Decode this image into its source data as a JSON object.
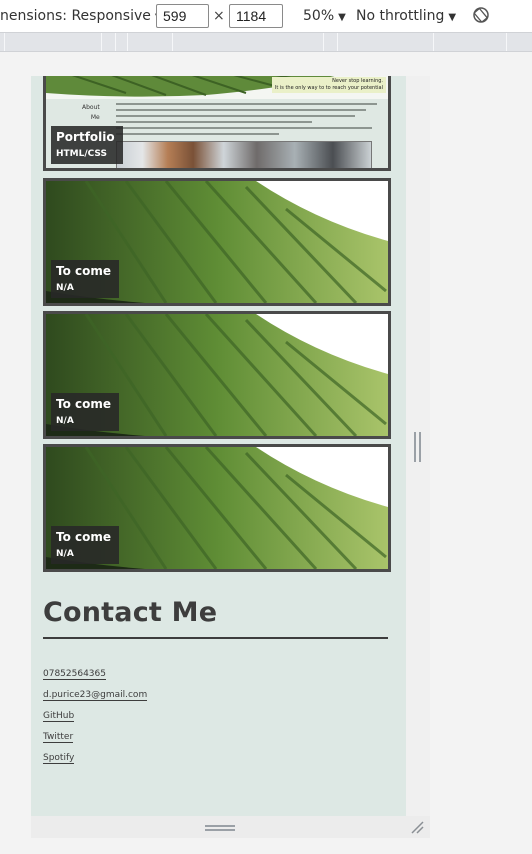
{
  "toolbar": {
    "dimensions_label": "nensions: Responsive",
    "width_value": "599",
    "height_value": "1184",
    "times": "×",
    "zoom": "50%",
    "throttling": "No throttling"
  },
  "portfolio_card": {
    "quote_line1": "Never stop learning.",
    "quote_line2": "It is the only way to to reach your potential",
    "about_line1": "About",
    "about_line2": "Me",
    "title": "Portfolio",
    "subtitle": "HTML/CSS"
  },
  "cards": [
    {
      "title": "To come",
      "subtitle": "N/A"
    },
    {
      "title": "To come",
      "subtitle": "N/A"
    },
    {
      "title": "To come",
      "subtitle": "N/A"
    }
  ],
  "contact": {
    "heading": "Contact Me",
    "links": [
      "07852564365",
      "d.purice23@gmail.com",
      "GitHub",
      "Twitter",
      "Spotify"
    ]
  },
  "colors": {
    "page_background": "#dde8e4",
    "card_border": "#4a4a4a",
    "label_background": "#282828",
    "heading_text": "#3d3d3d"
  }
}
